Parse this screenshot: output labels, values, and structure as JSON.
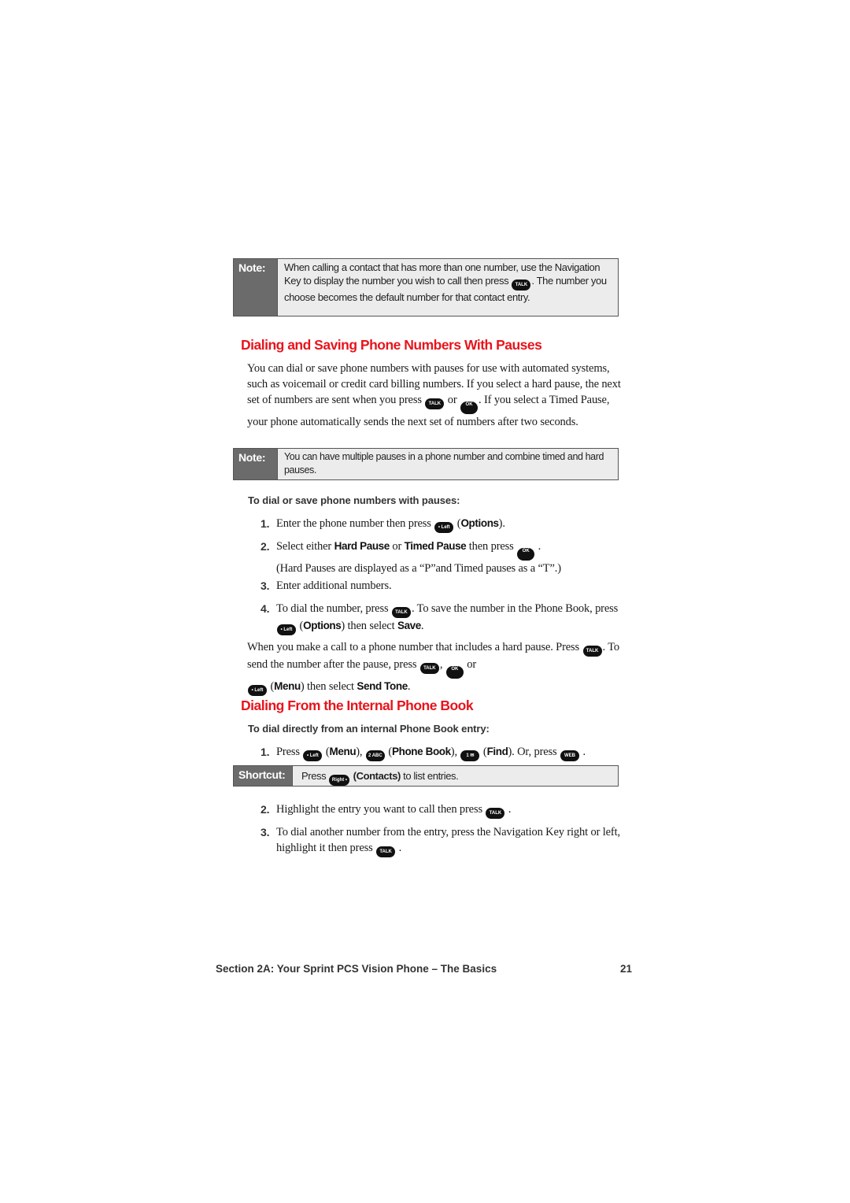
{
  "note1": {
    "label": "Note:",
    "text_a": "When calling a contact that has more than one number, use the Navigation Key to display the number you wish to call then press",
    "key": "TALK",
    "text_b": ". The number you choose becomes the default number for that contact entry."
  },
  "section1": {
    "heading": "Dialing and Saving Phone Numbers With Pauses",
    "para_a": "You can dial or save phone numbers with pauses for use with automated systems, such as voicemail or credit card billing numbers. If you select a hard pause, the next set of numbers are sent when you press",
    "para_or": "or",
    "para_b": ". If you select a Timed Pause, your phone automatically sends the next set of numbers after two seconds.",
    "key_talk": "TALK",
    "key_ok": "OK"
  },
  "note2": {
    "label": "Note:",
    "text": "You can have multiple pauses in a phone number and combine timed and hard pauses."
  },
  "procedure1": {
    "subhead": "To dial or save phone numbers with pauses:",
    "steps": [
      {
        "num": "1.",
        "a": "Enter the phone number then press",
        "key": "• Left",
        "b": "(",
        "bold": "Options",
        "c": ")."
      },
      {
        "num": "2.",
        "a": "Select either",
        "bold1": "Hard Pause",
        "or": "or",
        "bold2": "Timed Pause",
        "b": "then press",
        "key": "OK",
        "c": ".",
        "d": "(Hard Pauses are displayed as a “P”and Timed pauses as a “T”.)"
      },
      {
        "num": "3.",
        "a": "Enter additional numbers."
      },
      {
        "num": "4.",
        "a": "To dial the number, press",
        "key1": "TALK",
        "b": ".  To save the number in the Phone Book, press",
        "key2": "• Left",
        "c": "(",
        "bold1": "Options",
        "d": ") then select",
        "bold2": "Save",
        "e": "."
      }
    ]
  },
  "para2": {
    "a": "When you make a call to a phone number that includes a hard pause. Press",
    "key1": "TALK",
    "b": ". To send the number after the pause, press",
    "key2": "TALK",
    "c": ",",
    "key3": "OK",
    "d": "or",
    "key4": "• Left",
    "e": "(",
    "bold1": "Menu",
    "f": ") then select",
    "bold2": "Send Tone",
    "g": "."
  },
  "section2": {
    "heading": "Dialing From the Internal Phone Book",
    "subhead": "To dial directly from an internal Phone Book entry:",
    "step1": {
      "num": "1.",
      "a": "Press",
      "key1": "• Left",
      "b": "(",
      "bold1": "Menu",
      "c": "),",
      "key2": "2 ABC",
      "d": "(",
      "bold2": "Phone Book",
      "e": "),",
      "key3": "1 ✉",
      "f": "(",
      "bold3": "Find",
      "g": "). Or, press",
      "key4": "WEB",
      "h": "."
    },
    "shortcut": {
      "label": "Shortcut:",
      "a": "Press",
      "key": "Right •",
      "bold": "(Contacts)",
      "b": "to list entries."
    },
    "step2": {
      "num": "2.",
      "a": "Highlight the entry you want to call then press",
      "key": "TALK",
      "b": "."
    },
    "step3": {
      "num": "3.",
      "a": "To dial another number from the entry, press the Navigation Key right or left, highlight it then press",
      "key": "TALK",
      "b": "."
    }
  },
  "footer": {
    "section": "Section 2A: Your Sprint PCS Vision Phone – The Basics",
    "page": "21"
  }
}
